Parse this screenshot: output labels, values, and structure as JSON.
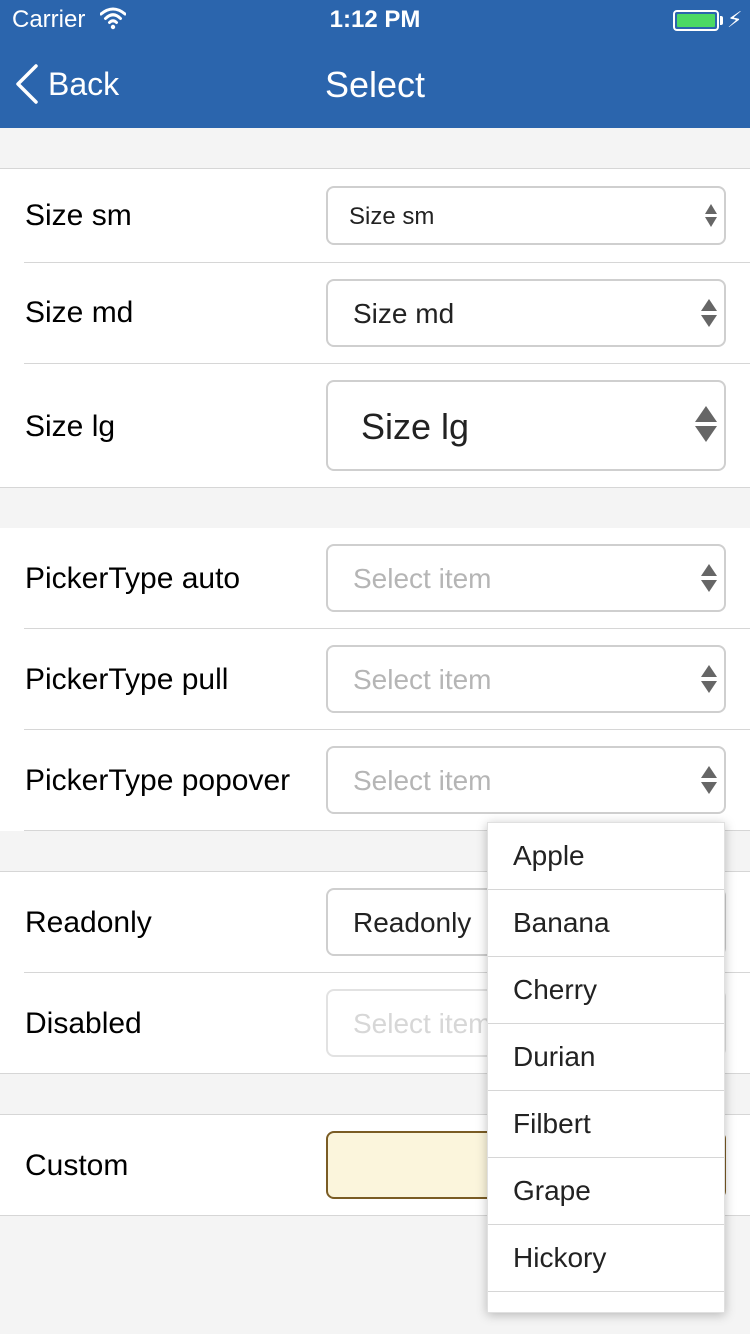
{
  "status_bar": {
    "carrier": "Carrier",
    "time": "1:12 PM",
    "battery_color": "#4cd964"
  },
  "nav": {
    "back_label": "Back",
    "title": "Select",
    "color": "#2b65ad"
  },
  "sizes": [
    {
      "label": "Size sm",
      "value": "Size sm"
    },
    {
      "label": "Size md",
      "value": "Size md"
    },
    {
      "label": "Size lg",
      "value": "Size lg"
    }
  ],
  "picker_types": [
    {
      "label": "PickerType auto",
      "placeholder": "Select item"
    },
    {
      "label": "PickerType pull",
      "placeholder": "Select item"
    },
    {
      "label": "PickerType popover",
      "placeholder": "Select item"
    }
  ],
  "states": [
    {
      "label": "Readonly",
      "value": "Readonly"
    },
    {
      "label": "Disabled",
      "placeholder": "Select item"
    }
  ],
  "custom": {
    "label": "Custom",
    "background": "#fbf5dc",
    "border": "#7a5c24"
  },
  "popover": {
    "options": [
      "Apple",
      "Banana",
      "Cherry",
      "Durian",
      "Filbert",
      "Grape",
      "Hickory"
    ]
  }
}
